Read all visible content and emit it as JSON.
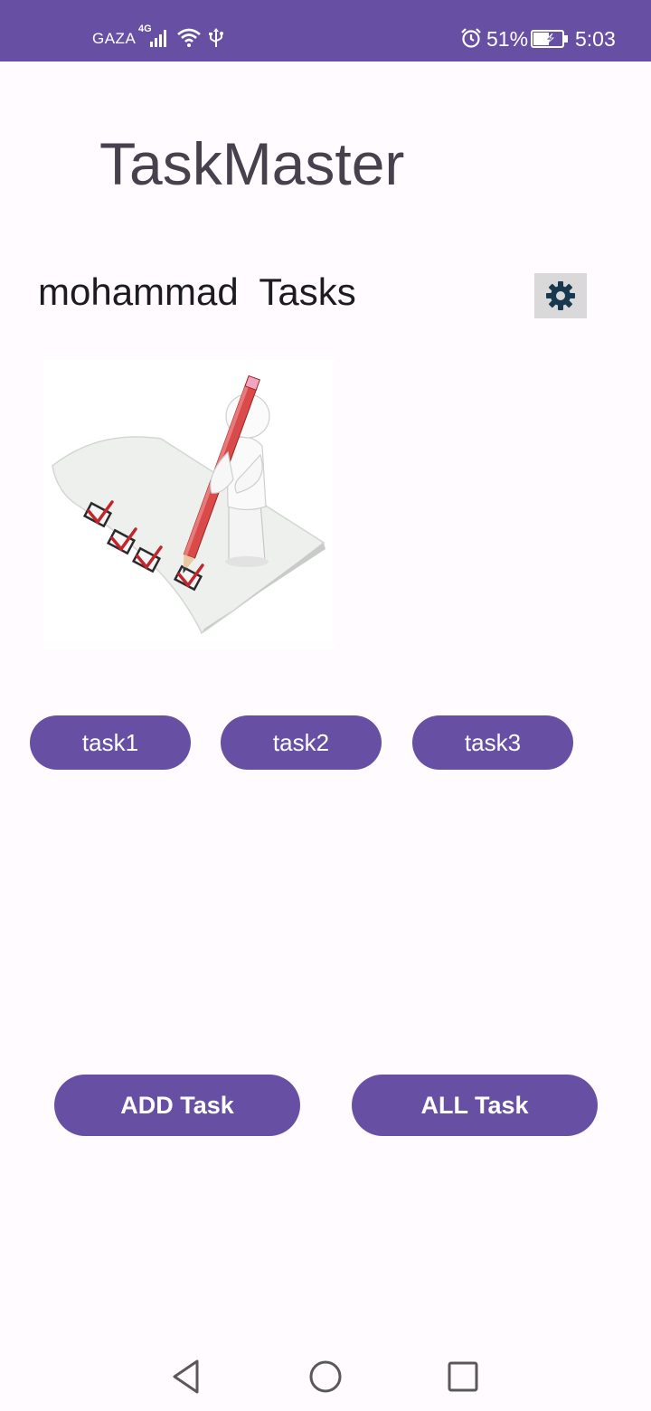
{
  "status_bar": {
    "carrier": "GAZA",
    "network": "4G",
    "battery": "51%",
    "time": "5:03",
    "background": "#6750a4"
  },
  "app": {
    "title": "TaskMaster",
    "user_tasks_heading": "mohammad  Tasks",
    "settings_icon": "gear-icon",
    "illustration": "checklist-figure-with-pencil"
  },
  "tasks": [
    {
      "label": "task1"
    },
    {
      "label": "task2"
    },
    {
      "label": "task3"
    }
  ],
  "actions": {
    "add_label": "ADD Task",
    "all_label": "ALL Task"
  },
  "nav": {
    "back_icon": "back-triangle-icon",
    "home_icon": "home-circle-icon",
    "recents_icon": "recents-square-icon"
  },
  "colors": {
    "primary": "#6750a4",
    "background": "#fffbfe",
    "title_text": "#45424e",
    "gear": "#17384f",
    "settings_bg": "#d9d9d9"
  }
}
